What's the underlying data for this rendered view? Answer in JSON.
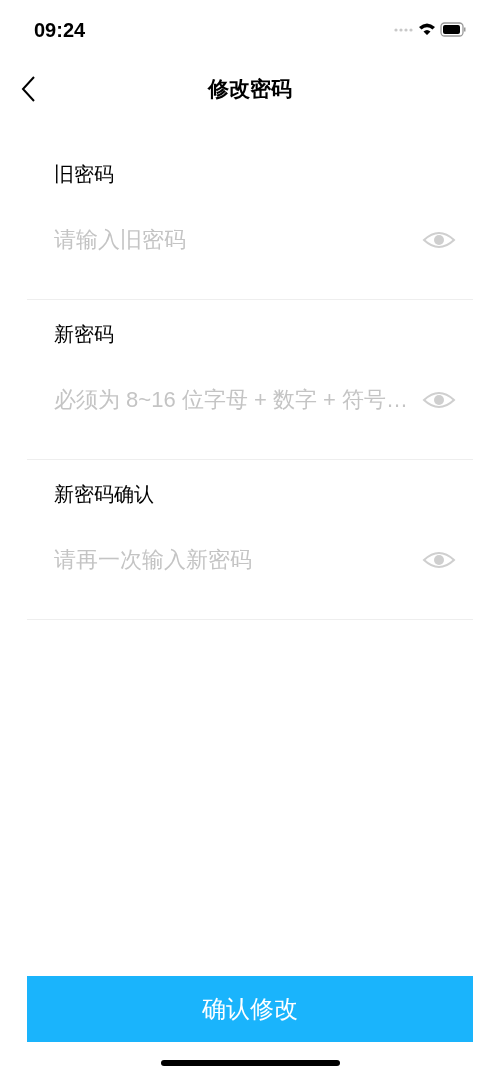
{
  "status_bar": {
    "time": "09:24"
  },
  "nav": {
    "title": "修改密码"
  },
  "fields": [
    {
      "label": "旧密码",
      "placeholder": "请输入旧密码"
    },
    {
      "label": "新密码",
      "placeholder": "必须为 8~16 位字母 + 数字 + 符号…"
    },
    {
      "label": "新密码确认",
      "placeholder": "请再一次输入新密码"
    }
  ],
  "submit": "确认修改"
}
